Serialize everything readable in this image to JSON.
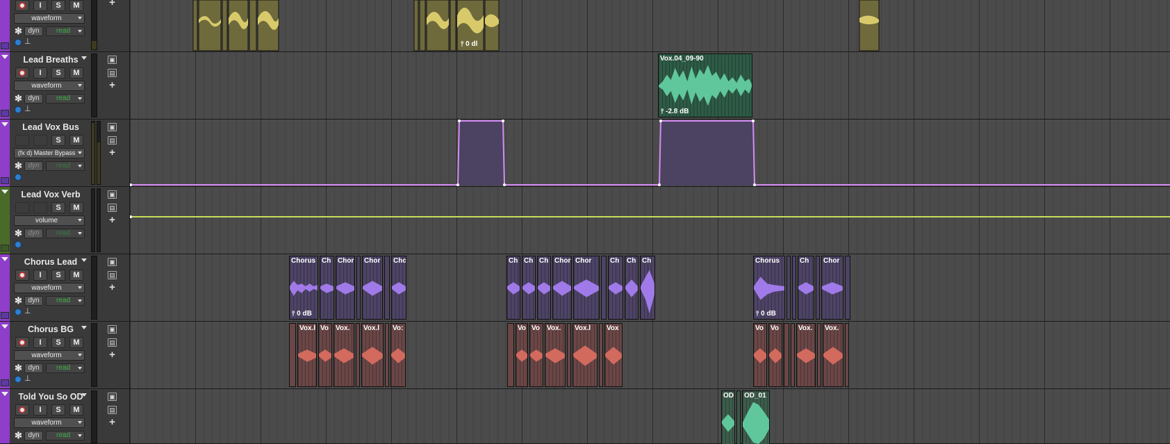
{
  "tracks": [
    {
      "name": "",
      "color": "#8e3ec9",
      "view": "waveform",
      "automation": "read",
      "dyn": "dyn",
      "buttons": {
        "i": "I",
        "s": "S",
        "m": "M"
      },
      "clips": [
        {
          "label": "0 dl",
          "color": "#d8ca6a"
        }
      ]
    },
    {
      "name": "Lead Breaths",
      "color": "#8e3ec9",
      "view": "waveform",
      "automation": "read",
      "dyn": "dyn",
      "buttons": {
        "i": "I",
        "s": "S",
        "m": "M"
      },
      "clips": [
        {
          "label": "Vox.04_09-90",
          "gain": "-2.8 dB",
          "color": "#5fc79b"
        }
      ]
    },
    {
      "name": "Lead Vox Bus",
      "color": "#8e3ec9",
      "view": "(fx d) Master Bypass",
      "automation": "read",
      "dyn": "dyn",
      "buttons": {
        "s": "S",
        "m": "M"
      }
    },
    {
      "name": "Lead Vox Verb",
      "color": "#4a6a2a",
      "view": "volume",
      "automation": "read",
      "dyn": "dyn",
      "buttons": {
        "s": "S",
        "m": "M"
      }
    },
    {
      "name": "Chorus Lead",
      "color": "#8e3ec9",
      "view": "waveform",
      "automation": "read",
      "dyn": "dyn",
      "buttons": {
        "i": "I",
        "s": "S",
        "m": "M"
      },
      "clips": [
        {
          "label": "Chorus",
          "gain": "0 dB"
        },
        {
          "label": "Ch"
        },
        {
          "label": "Chor"
        },
        {
          "label": "Chor"
        },
        {
          "label": "Cho"
        },
        {
          "label": "Ch"
        },
        {
          "label": "Ch"
        },
        {
          "label": "Ch"
        },
        {
          "label": "Chor"
        },
        {
          "label": "Chor"
        },
        {
          "label": "Ch"
        },
        {
          "label": "Ch"
        },
        {
          "label": "Ch"
        },
        {
          "label": "Chorus",
          "gain2": "0 dB"
        },
        {
          "label": "Ch"
        },
        {
          "label": "Chor"
        }
      ]
    },
    {
      "name": "Chorus BG",
      "color": "#8e3ec9",
      "view": "waveform",
      "automation": "read",
      "dyn": "dyn",
      "buttons": {
        "i": "I",
        "s": "S",
        "m": "M"
      },
      "clips": [
        {
          "label": "Vox.l"
        },
        {
          "label": "Vo"
        },
        {
          "label": "Vox."
        },
        {
          "label": "Vox.l"
        },
        {
          "label": "Vo:"
        },
        {
          "label": "Vo"
        },
        {
          "label": "Vo"
        },
        {
          "label": "Vox."
        },
        {
          "label": "Vox.l"
        },
        {
          "label": "Vox"
        },
        {
          "label": "Vo"
        },
        {
          "label": "Vo"
        },
        {
          "label": "Vox."
        },
        {
          "label": "Vox."
        }
      ]
    },
    {
      "name": "Told You So OD",
      "color": "#8e3ec9",
      "view": "waveform",
      "automation": "read",
      "dyn": "dyn",
      "buttons": {
        "i": "I",
        "s": "S",
        "m": "M"
      },
      "clips": [
        {
          "label": "OD"
        },
        {
          "label": "OD_01"
        }
      ]
    }
  ],
  "icons": {
    "record": "record-icon",
    "playlist": "playlist-icon",
    "add": "add-lane-icon"
  }
}
